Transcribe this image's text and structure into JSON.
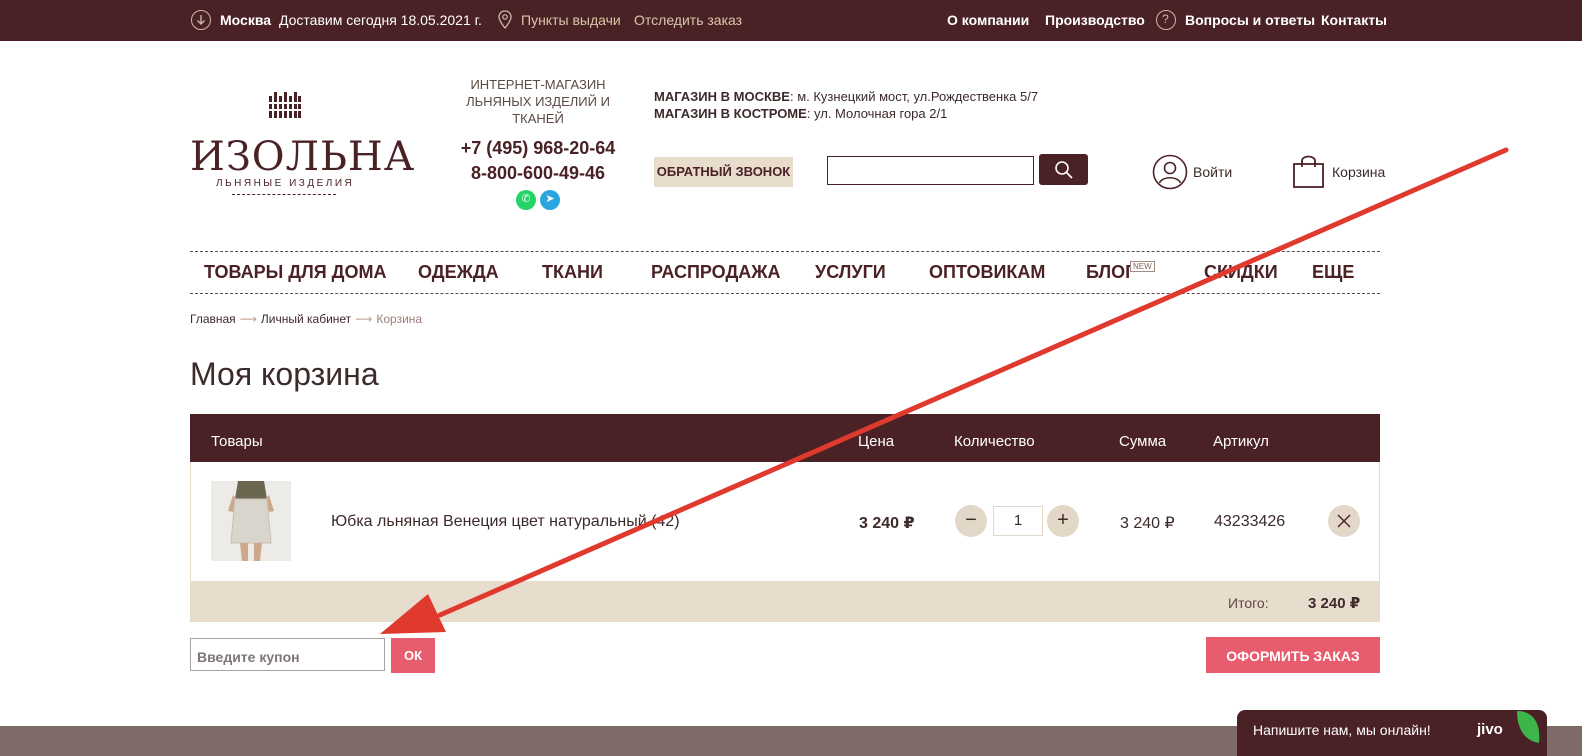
{
  "topbar": {
    "city": "Москва",
    "delivery": "Доставим сегодня 18.05.2021 г.",
    "pickup": "Пункты выдачи",
    "track": "Отследить заказ",
    "links": [
      "О компании",
      "Производство",
      "Вопросы и ответы",
      "Контакты"
    ]
  },
  "header": {
    "logo_name": "ИЗОЛЬНА",
    "logo_sub": "ЛЬНЯНЫЕ ИЗДЕЛИЯ",
    "shop_title": "ИНТЕРНЕТ-МАГАЗИН ЛЬНЯНЫХ ИЗДЕЛИЙ И ТКАНЕЙ",
    "phone1": "+7 (495) 968-20-64",
    "phone2": "8-800-600-49-46",
    "store_moscow_label": "МАГАЗИН В МОСКВЕ",
    "store_moscow_addr": ": м. Кузнецкий мост, ул.Рождественка 5/7",
    "store_kostroma_label": "МАГАЗИН В КОСТРОМЕ",
    "store_kostroma_addr": ": ул. Молочная гора 2/1",
    "callback": "ОБРАТНЫЙ ЗВОНОК",
    "search_value": "",
    "login": "Войти",
    "cart": "Корзина"
  },
  "nav": {
    "items": [
      "ТОВАРЫ ДЛЯ ДОМА",
      "ОДЕЖДА",
      "ТКАНИ",
      "РАСПРОДАЖА",
      "УСЛУГИ",
      "ОПТОВИКАМ",
      "БЛОГ",
      "СКИДКИ",
      "ЕЩЕ"
    ],
    "new_badge": "NEW"
  },
  "breadcrumb": {
    "home": "Главная",
    "account": "Личный кабинет",
    "current": "Корзина",
    "sep": "⟶"
  },
  "page_title": "Моя корзина",
  "table": {
    "headers": [
      "Товары",
      "Цена",
      "Количество",
      "Сумма",
      "Артикул"
    ],
    "rows": [
      {
        "name": "Юбка льняная Венеция цвет натуральный (42)",
        "price": "3 240 ₽",
        "qty": "1",
        "sum": "3 240 ₽",
        "sku": "43233426"
      }
    ],
    "total_label": "Итого:",
    "total_value": "3 240 ₽"
  },
  "coupon": {
    "placeholder": "Введите купон",
    "ok": "ОК"
  },
  "checkout": "ОФОРМИТЬ ЗАКАЗ",
  "chat": {
    "text": "Напишите нам, мы онлайн!",
    "brand": "jivo"
  },
  "colors": {
    "brand": "#4a2226",
    "accent": "#e85d6e",
    "beige": "#e8dccd",
    "annotation_arrow": "#e03a2f"
  }
}
